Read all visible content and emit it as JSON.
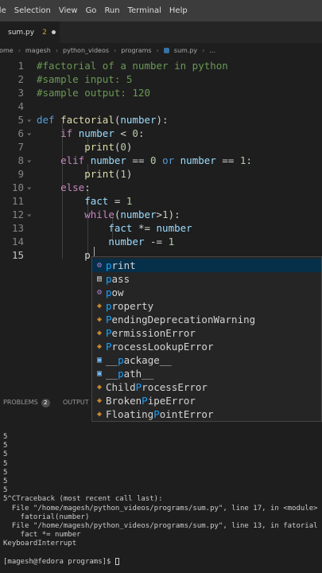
{
  "menubar": {
    "items": [
      "File",
      "Selection",
      "View",
      "Go",
      "Run",
      "Terminal",
      "Help"
    ]
  },
  "tab": {
    "name": "sum.py",
    "count": "2"
  },
  "breadcrumb": [
    "home",
    "magesh",
    "python_videos",
    "programs",
    "sum.py",
    "..."
  ],
  "editor": {
    "lines": [
      {
        "n": "1",
        "segs": [
          [
            "c-comment",
            "#factorial of a number in python"
          ]
        ]
      },
      {
        "n": "2",
        "segs": [
          [
            "c-comment",
            "#sample input: 5"
          ]
        ]
      },
      {
        "n": "3",
        "segs": [
          [
            "c-comment",
            "#sample output: 120"
          ]
        ]
      },
      {
        "n": "4",
        "segs": []
      },
      {
        "n": "5",
        "fold": true,
        "segs": [
          [
            "c-kw",
            "def "
          ],
          [
            "c-fn",
            "factorial"
          ],
          [
            "c-op",
            "("
          ],
          [
            "c-var",
            "number"
          ],
          [
            "c-op",
            "):"
          ]
        ]
      },
      {
        "n": "6",
        "fold": true,
        "segs": [
          [
            "c-op",
            "    "
          ],
          [
            "c-ctrl",
            "if "
          ],
          [
            "c-var",
            "number"
          ],
          [
            "c-op",
            " < "
          ],
          [
            "c-num",
            "0"
          ],
          [
            "c-op",
            ":"
          ]
        ]
      },
      {
        "n": "7",
        "segs": [
          [
            "c-op",
            "        "
          ],
          [
            "c-fn",
            "print"
          ],
          [
            "c-op",
            "("
          ],
          [
            "c-num",
            "0"
          ],
          [
            "c-op",
            ")"
          ]
        ]
      },
      {
        "n": "8",
        "fold": true,
        "segs": [
          [
            "c-op",
            "    "
          ],
          [
            "c-ctrl",
            "elif "
          ],
          [
            "c-var",
            "number"
          ],
          [
            "c-op",
            " == "
          ],
          [
            "c-num",
            "0"
          ],
          [
            "c-kw",
            " or "
          ],
          [
            "c-var",
            "number"
          ],
          [
            "c-op",
            " == "
          ],
          [
            "c-num",
            "1"
          ],
          [
            "c-op",
            ":"
          ]
        ]
      },
      {
        "n": "9",
        "segs": [
          [
            "c-op",
            "        "
          ],
          [
            "c-fn",
            "print"
          ],
          [
            "c-op",
            "("
          ],
          [
            "c-num",
            "1"
          ],
          [
            "c-op",
            ")"
          ]
        ]
      },
      {
        "n": "10",
        "fold": true,
        "segs": [
          [
            "c-op",
            "    "
          ],
          [
            "c-ctrl",
            "else"
          ],
          [
            "c-op",
            ":"
          ]
        ]
      },
      {
        "n": "11",
        "segs": [
          [
            "c-op",
            "        "
          ],
          [
            "c-var",
            "fact"
          ],
          [
            "c-op",
            " = "
          ],
          [
            "c-num",
            "1"
          ]
        ]
      },
      {
        "n": "12",
        "fold": true,
        "segs": [
          [
            "c-op",
            "        "
          ],
          [
            "c-ctrl",
            "while"
          ],
          [
            "c-op",
            "("
          ],
          [
            "c-var",
            "number"
          ],
          [
            "c-op",
            ">"
          ],
          [
            "c-num",
            "1"
          ],
          [
            "c-op",
            "):"
          ]
        ]
      },
      {
        "n": "13",
        "segs": [
          [
            "c-op",
            "            "
          ],
          [
            "c-var",
            "fact"
          ],
          [
            "c-op",
            " *= "
          ],
          [
            "c-var",
            "number"
          ]
        ]
      },
      {
        "n": "14",
        "segs": [
          [
            "c-op",
            "            "
          ],
          [
            "c-var",
            "number"
          ],
          [
            "c-op",
            " -= "
          ],
          [
            "c-num",
            "1"
          ]
        ]
      },
      {
        "n": "15",
        "active": true,
        "segs": [
          [
            "c-op",
            "        "
          ],
          [
            "c-op",
            "p"
          ]
        ]
      }
    ]
  },
  "suggest": {
    "items": [
      {
        "icon": "method",
        "glyph": "⚙",
        "pre": "",
        "match": "p",
        "rest": "rint",
        "selected": true
      },
      {
        "icon": "keyword",
        "glyph": "▤",
        "pre": "",
        "match": "p",
        "rest": "ass"
      },
      {
        "icon": "method",
        "glyph": "⚙",
        "pre": "",
        "match": "p",
        "rest": "ow"
      },
      {
        "icon": "class",
        "glyph": "◈",
        "pre": "",
        "match": "p",
        "rest": "roperty"
      },
      {
        "icon": "class",
        "glyph": "◈",
        "pre": "",
        "match": "P",
        "rest": "endingDeprecationWarning"
      },
      {
        "icon": "class",
        "glyph": "◈",
        "pre": "",
        "match": "P",
        "rest": "ermissionError"
      },
      {
        "icon": "class",
        "glyph": "◈",
        "pre": "",
        "match": "P",
        "rest": "rocessLookupError"
      },
      {
        "icon": "variable",
        "glyph": "▣",
        "pre": "__",
        "match": "p",
        "rest": "ackage__"
      },
      {
        "icon": "variable",
        "glyph": "▣",
        "pre": "__",
        "match": "p",
        "rest": "ath__"
      },
      {
        "icon": "class",
        "glyph": "◈",
        "pre": "Child",
        "match": "P",
        "rest": "rocessError"
      },
      {
        "icon": "class",
        "glyph": "◈",
        "pre": "Broken",
        "match": "P",
        "rest": "ipeError"
      },
      {
        "icon": "class",
        "glyph": "◈",
        "pre": "Floating",
        "match": "P",
        "rest": "ointError"
      }
    ]
  },
  "panel": {
    "problems": "PROBLEMS",
    "problems_count": "2",
    "output": "OUTPUT"
  },
  "terminal": {
    "lines": [
      "5",
      "5",
      "5",
      "5",
      "5",
      "5",
      "5",
      "5^CTraceback (most recent call last):",
      "  File \"/home/magesh/python_videos/programs/sum.py\", line 17, in <module>",
      "    fatorial(number)",
      "  File \"/home/magesh/python_videos/programs/sum.py\", line 13, in fatorial",
      "    fact *= number",
      "KeyboardInterrupt",
      "",
      "[magesh@fedora programs]$ "
    ]
  }
}
